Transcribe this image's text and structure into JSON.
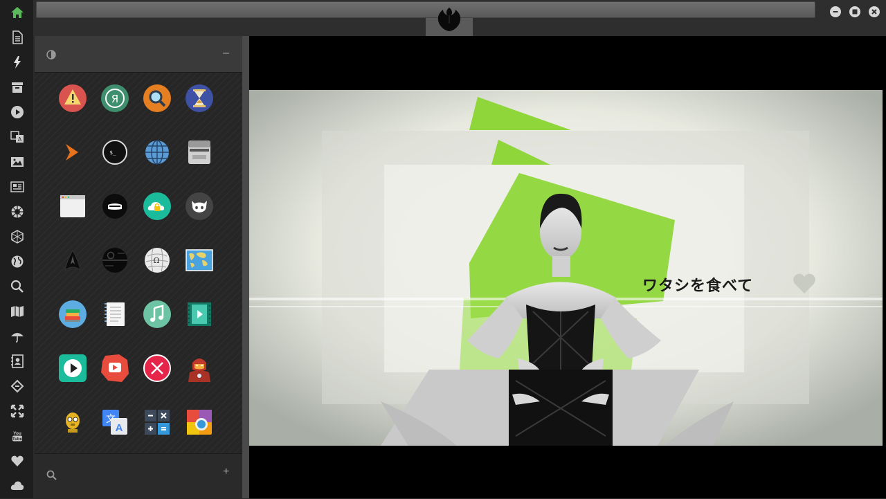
{
  "window": {
    "logo": "rebel-alliance-logo",
    "controls": [
      "minimize",
      "maximize",
      "close"
    ]
  },
  "rail": {
    "items": [
      "home-icon",
      "document-icon",
      "lightning-icon",
      "archive-icon",
      "play-icon",
      "translate-icon",
      "image-icon",
      "news-icon",
      "settings-icon",
      "hexagon-icon",
      "globe-icon",
      "search-icon",
      "map-icon",
      "umbrella-icon",
      "contacts-icon",
      "code-icon",
      "expand-icon",
      "youtube-icon",
      "heart-icon",
      "cloud-icon"
    ],
    "active_color": "#5cb85c",
    "youtube_label": "You Tube"
  },
  "drawer": {
    "header": {
      "theme_icon": "half-circle-icon",
      "collapse": "–"
    },
    "footer": {
      "search_icon": "search-icon",
      "add": "+"
    },
    "apps": [
      [
        "warning-app",
        "yandex-app",
        "search-app",
        "hourglass-app"
      ],
      [
        "launcher-app",
        "terminal-app",
        "globe-app",
        "scanner-app"
      ],
      [
        "browser-window-app",
        "mouth-app",
        "cloud-lock-app",
        "github-app"
      ],
      [
        "starfleet-app",
        "death-star-app",
        "wikipedia-app",
        "world-map-app"
      ],
      [
        "library-app",
        "notes-app",
        "music-app",
        "video-player-app"
      ],
      [
        "play-app",
        "youtube-app",
        "close-app",
        "ironman-app"
      ],
      [
        "c3po-app",
        "translate-app",
        "calculator-app",
        "photos-app"
      ]
    ],
    "yandex_letter": "Я",
    "terminal_text": "$_"
  },
  "video": {
    "overlay_text": "ワタシを食べて",
    "accent": "#8ed63a"
  }
}
